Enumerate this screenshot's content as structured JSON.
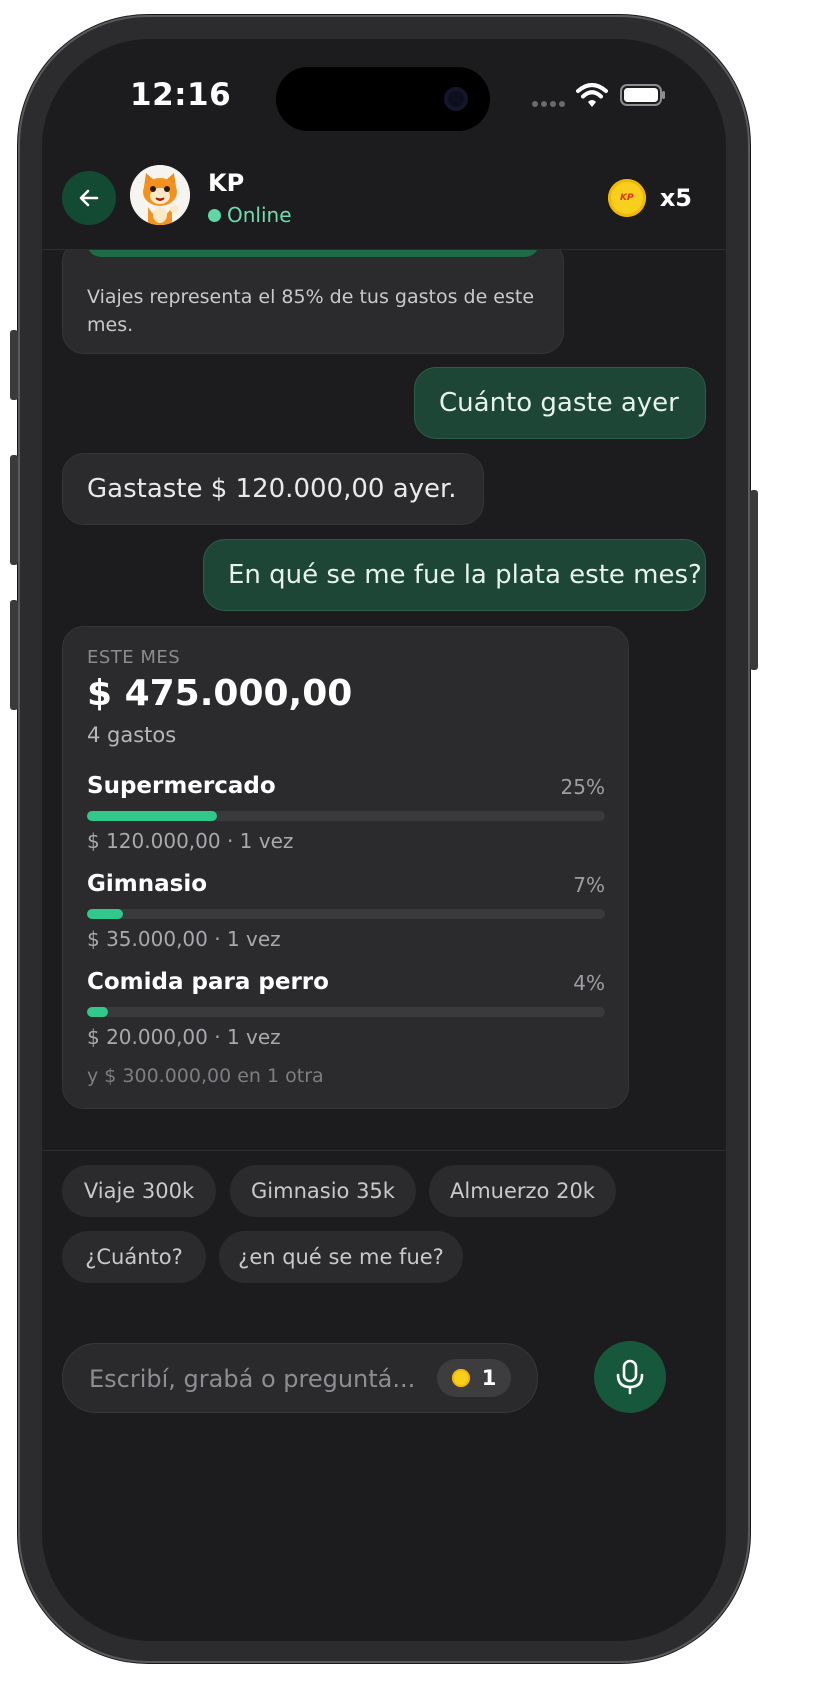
{
  "status_bar": {
    "time": "12:16"
  },
  "header": {
    "contact_name": "KP",
    "status": "Online",
    "coin_label": "KP",
    "coin_count": "x5"
  },
  "messages": [
    {
      "from": "bot",
      "text": "Viajes representa el 85% de tus gastos de este mes.",
      "lines": [
        "Viajes representa el 85% de tus gastos de este",
        "mes."
      ]
    },
    {
      "from": "user",
      "text": "Cuánto gaste ayer"
    },
    {
      "from": "bot",
      "text": "Gastaste $ 120.000,00 ayer."
    },
    {
      "from": "user",
      "text": "En qué se me fue la plata este mes?"
    }
  ],
  "summary_card": {
    "label": "ESTE MES",
    "total": "$ 475.000,00",
    "count": "4 gastos",
    "categories": [
      {
        "name": "Supermercado",
        "percent_label": "25%",
        "percent": 25,
        "detail": "$ 120.000,00 · 1 vez"
      },
      {
        "name": "Gimnasio",
        "percent_label": "7%",
        "percent": 7,
        "detail": "$ 35.000,00 · 1 vez"
      },
      {
        "name": "Comida para perro",
        "percent_label": "4%",
        "percent": 4,
        "detail": "$ 20.000,00 · 1 vez"
      }
    ],
    "more": "y $ 300.000,00 en 1 otra"
  },
  "suggestions": [
    "Viaje 300k",
    "Gimnasio 35k",
    "Almuerzo 20k",
    "¿Cuánto?",
    "¿en qué se me fue?"
  ],
  "composer": {
    "placeholder": "Escribí, grabá o preguntá...",
    "cost": "1"
  },
  "colors": {
    "accent_green": "#31c98b",
    "user_bubble": "#1d4636",
    "bot_bubble": "#2b2b2e",
    "coin_yellow": "#f7cf1c"
  }
}
